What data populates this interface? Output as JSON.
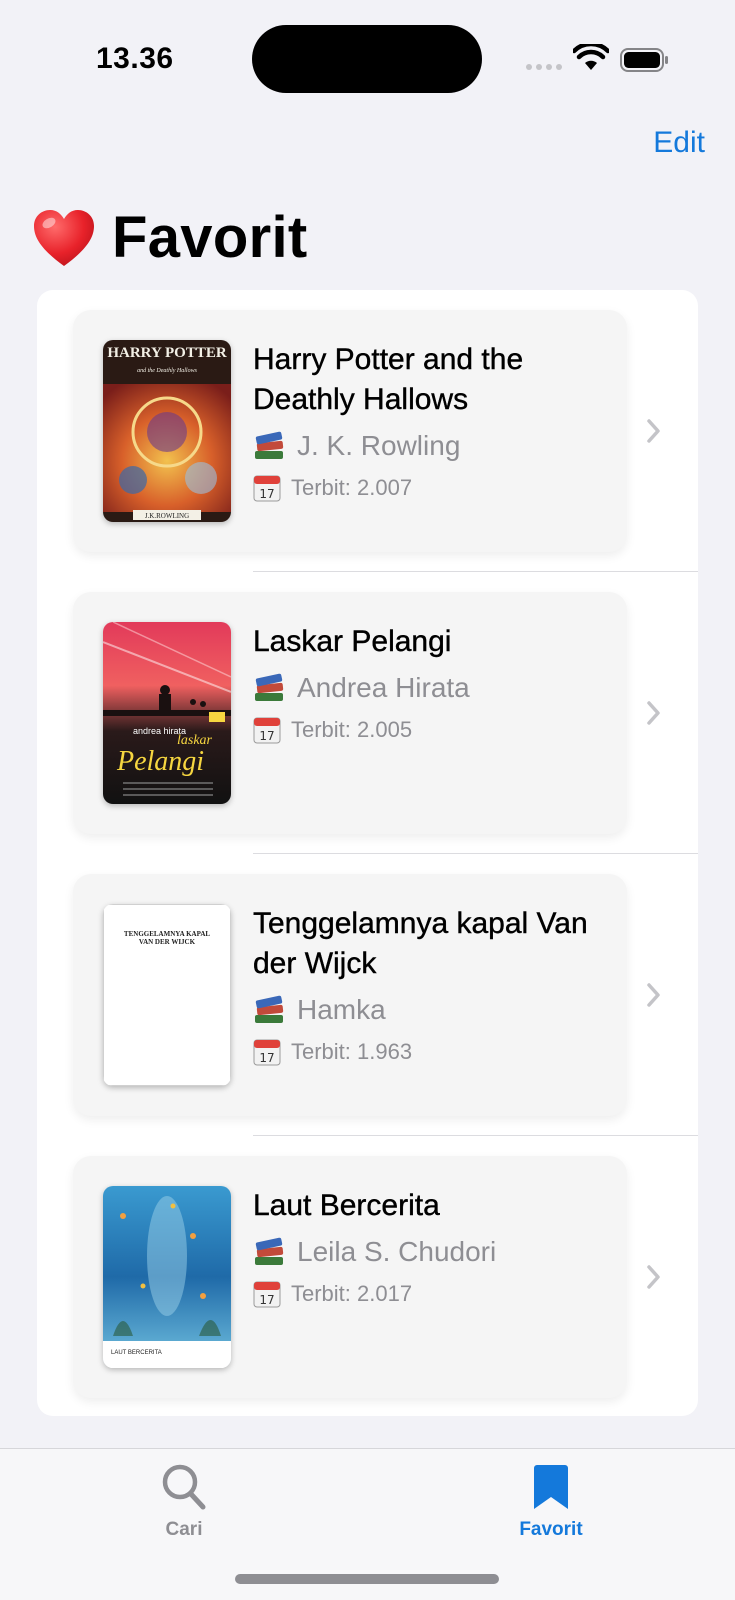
{
  "status_bar": {
    "time": "13.36"
  },
  "nav": {
    "edit_label": "Edit",
    "title": "Favorit",
    "title_icon": "heart-icon"
  },
  "books": [
    {
      "title": "Harry Potter and the Deathly Hallows",
      "author": "J. K. Rowling",
      "published": "Terbit: 2.007",
      "cover_text": "HARRY POTTER",
      "cover_subtext": "and the Deathly Hallows",
      "cover_footer": "J.K.ROWLING"
    },
    {
      "title": "Laskar Pelangi",
      "author": "Andrea Hirata",
      "published": "Terbit: 2.005",
      "cover_text": "laskar",
      "cover_subtext": "andrea hirata",
      "cover_footer": "Pelangi"
    },
    {
      "title": "Tenggelamnya kapal Van der Wijck",
      "author": "Hamka",
      "published": "Terbit: 1.963",
      "cover_text": "TENGGELAMNYA KAPAL",
      "cover_subtext": "VAN DER WIJCK"
    },
    {
      "title": "Laut Bercerita",
      "author": "Leila S. Chudori",
      "published": "Terbit: 2.017",
      "cover_text": "LAUT BERCERITA"
    }
  ],
  "tabs": [
    {
      "label": "Cari",
      "icon": "search-icon",
      "active": false
    },
    {
      "label": "Favorit",
      "icon": "bookmark-icon",
      "active": true
    }
  ],
  "colors": {
    "accent": "#1479db",
    "secondary_text": "#8e8e93",
    "background": "#f2f2f7"
  }
}
